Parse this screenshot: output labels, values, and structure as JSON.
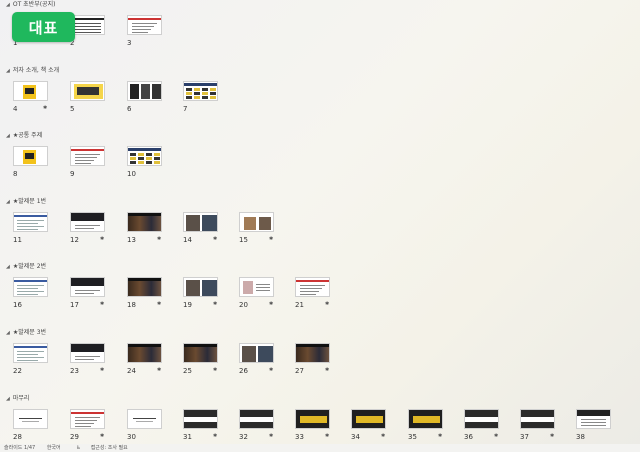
{
  "badge": {
    "label": "대표"
  },
  "sections": [
    {
      "title": "OT 초반부(공지)",
      "slides": [
        {
          "number": "1",
          "style": "badge",
          "anim": false
        },
        {
          "number": "2",
          "style": "table",
          "anim": false
        },
        {
          "number": "3",
          "style": "text",
          "anim": false
        }
      ]
    },
    {
      "title": "저자 소개, 책 소개",
      "slides": [
        {
          "number": "4",
          "style": "yellow",
          "anim": true
        },
        {
          "number": "5",
          "style": "yellowbox",
          "anim": false
        },
        {
          "number": "6",
          "style": "darkcols",
          "anim": false
        },
        {
          "number": "7",
          "style": "grid",
          "anim": false
        }
      ]
    },
    {
      "title": "★공통 주제",
      "slides": [
        {
          "number": "8",
          "style": "yellow",
          "anim": false
        },
        {
          "number": "9",
          "style": "text",
          "anim": false
        },
        {
          "number": "10",
          "style": "grid",
          "anim": false
        }
      ]
    },
    {
      "title": "★발제문 1번",
      "slides": [
        {
          "number": "11",
          "style": "doc",
          "anim": false
        },
        {
          "number": "12",
          "style": "darkbar",
          "anim": true
        },
        {
          "number": "13",
          "style": "photo",
          "anim": true
        },
        {
          "number": "14",
          "style": "photo2",
          "anim": true
        },
        {
          "number": "15",
          "style": "photo3",
          "anim": true
        }
      ]
    },
    {
      "title": "★발제문 2번",
      "slides": [
        {
          "number": "16",
          "style": "doc",
          "anim": false
        },
        {
          "number": "17",
          "style": "darkbar",
          "anim": true
        },
        {
          "number": "18",
          "style": "photo",
          "anim": true
        },
        {
          "number": "19",
          "style": "photo2",
          "anim": true
        },
        {
          "number": "20",
          "style": "textimg",
          "anim": true
        },
        {
          "number": "21",
          "style": "text",
          "anim": true
        }
      ]
    },
    {
      "title": "★발제문 3번",
      "slides": [
        {
          "number": "22",
          "style": "doc",
          "anim": false
        },
        {
          "number": "23",
          "style": "darkbar",
          "anim": true
        },
        {
          "number": "24",
          "style": "photo",
          "anim": true
        },
        {
          "number": "25",
          "style": "photo",
          "anim": true
        },
        {
          "number": "26",
          "style": "photo2",
          "anim": true
        },
        {
          "number": "27",
          "style": "photo",
          "anim": true
        }
      ]
    },
    {
      "title": "마무리",
      "slides": [
        {
          "number": "28",
          "style": "textline",
          "anim": false
        },
        {
          "number": "29",
          "style": "text",
          "anim": true
        },
        {
          "number": "30",
          "style": "textline",
          "anim": false
        },
        {
          "number": "31",
          "style": "darkstrip",
          "anim": true
        },
        {
          "number": "32",
          "style": "darkstrip",
          "anim": true
        },
        {
          "number": "33",
          "style": "darkyellow",
          "anim": true
        },
        {
          "number": "34",
          "style": "darkyellow",
          "anim": true
        },
        {
          "number": "35",
          "style": "darkyellow",
          "anim": true
        },
        {
          "number": "36",
          "style": "darkstrip",
          "anim": true
        },
        {
          "number": "37",
          "style": "darkstrip",
          "anim": true
        },
        {
          "number": "38",
          "style": "darktop",
          "anim": false
        }
      ]
    }
  ],
  "anim_glyph": "✱",
  "status": {
    "slide_info": "슬라이드 1/47",
    "language": "한국어",
    "accessibility": "접근성: 조사 필요"
  },
  "icons": {
    "accessibility": "accessibility-icon",
    "collapse": "collapse-triangle-icon",
    "animation": "animation-star-icon"
  }
}
